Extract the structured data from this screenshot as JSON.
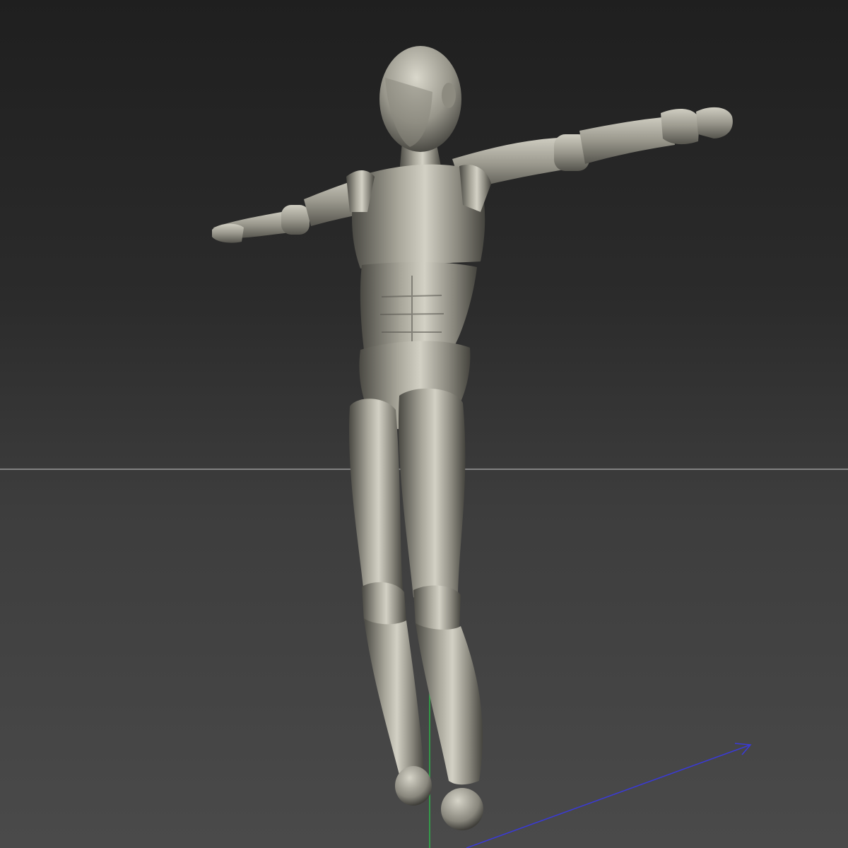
{
  "viewport": {
    "background_top": "#1f1f1f",
    "background_bottom": "#4a4a4a",
    "horizon_line_color": "#9a9a9a",
    "axis_y_color": "#2fb34a",
    "axis_x_color": "#3a3ad8",
    "model_color": "#8c8a7f",
    "model_highlight": "#d6d4c8",
    "model_shadow": "#3e3d38"
  },
  "model": {
    "name_icon": "mannequin-figure",
    "pose": "T-pose"
  }
}
